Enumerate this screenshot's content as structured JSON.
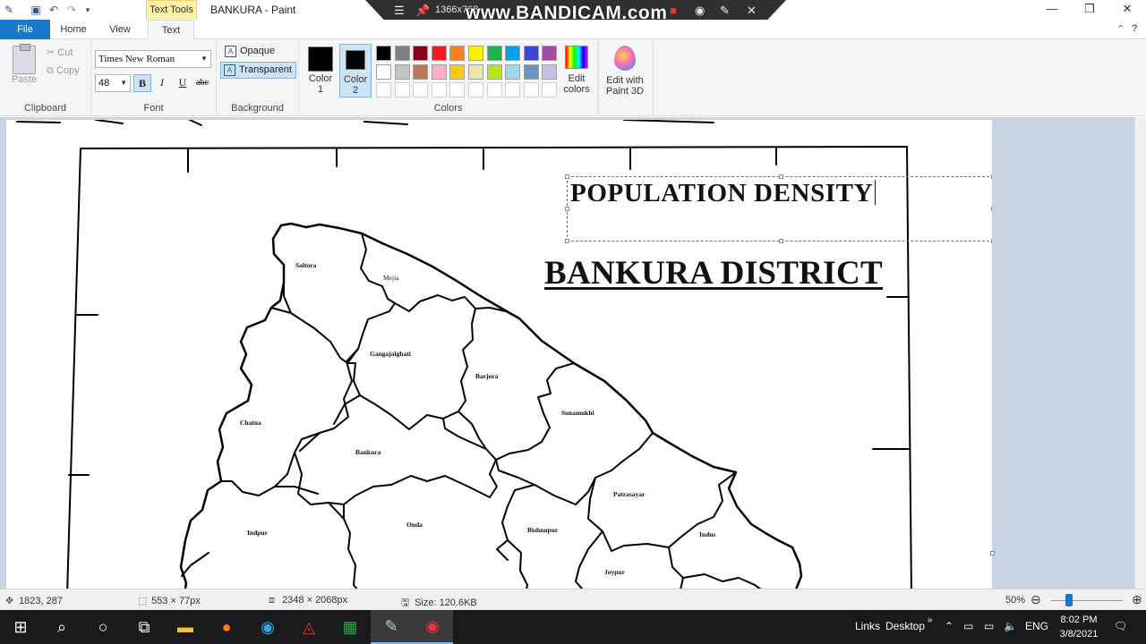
{
  "window": {
    "title": "BANKURA - Paint",
    "context_tab": "Text Tools",
    "controls": [
      "—",
      "❐",
      "✕"
    ]
  },
  "recorder": {
    "resolution": "1366x768",
    "watermark": "www.BANDICAM.com"
  },
  "tabs": {
    "file": "File",
    "home": "Home",
    "view": "View",
    "text": "Text",
    "active": "Text"
  },
  "clipboard": {
    "paste": "Paste",
    "cut": "Cut",
    "copy": "Copy",
    "group_label": "Clipboard"
  },
  "font": {
    "family": "Times New Roman",
    "size": "48",
    "bold": "B",
    "italic": "I",
    "underline": "U",
    "strikethrough": "abc",
    "group_label": "Font"
  },
  "background": {
    "opaque": "Opaque",
    "transparent": "Transparent",
    "group_label": "Background"
  },
  "colors": {
    "color1_label": "Color 1",
    "color1_label_l1": "Color",
    "color1_label_l2": "1",
    "color2_label_l1": "Color",
    "color2_label_l2": "2",
    "color1": "#000000",
    "color2": "#000000",
    "palette_row1": [
      "#000000",
      "#7f7f7f",
      "#880015",
      "#ed1c24",
      "#ff7f27",
      "#fff200",
      "#22b14c",
      "#00a2e8",
      "#3f48cc",
      "#a349a4"
    ],
    "palette_row2": [
      "#ffffff",
      "#c3c3c3",
      "#b97a57",
      "#ffaec9",
      "#ffc90e",
      "#efe4b0",
      "#b5e61d",
      "#99d9ea",
      "#7092be",
      "#c8bfe7"
    ],
    "palette_row3": [
      "#ffffff",
      "#ffffff",
      "#ffffff",
      "#ffffff",
      "#ffffff",
      "#ffffff",
      "#ffffff",
      "#ffffff",
      "#ffffff",
      "#ffffff"
    ],
    "edit_colors_l1": "Edit",
    "edit_colors_l2": "colors",
    "paint3d_l1": "Edit with",
    "paint3d_l2": "Paint 3D",
    "group_label": "Colors"
  },
  "canvas": {
    "textbox_text": "POPULATION DENSITY",
    "map_title": "BANKURA DISTRICT",
    "districts": {
      "saltora": "Saltora",
      "mejia": "Mejia",
      "gangajalghati": "Gangajalghati",
      "barjora": "Barjora",
      "sonamukhi": "Sonamukhi",
      "chatna": "Chatna",
      "bankura": "Bankura",
      "onda": "Onda",
      "patrasayar": "Patrasayar",
      "indpur": "Indpur",
      "bishnupur": "Bishnupur",
      "indus": "Indus",
      "joypur": "Joypur"
    }
  },
  "status": {
    "cursor": "1823, 287",
    "selection": "553 × 77px",
    "image_size": "2348 × 2068px",
    "file_size": "Size: 120.6KB",
    "zoom": "50%"
  },
  "taskbar": {
    "links": "Links",
    "desktop": "Desktop",
    "lang": "ENG",
    "time": "8:02 PM",
    "date": "3/8/2021"
  }
}
